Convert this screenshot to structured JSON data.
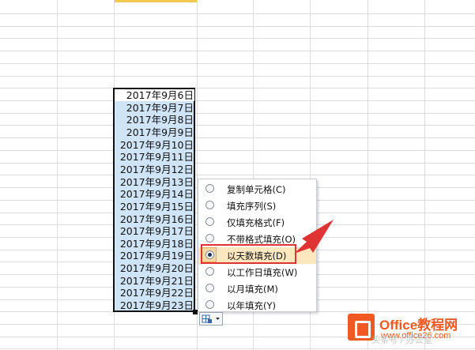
{
  "sheet": {
    "dates": [
      "2017年9月6日",
      "2017年9月7日",
      "2017年9月8日",
      "2017年9月9日",
      "2017年9月10日",
      "2017年9月11日",
      "2017年9月12日",
      "2017年9月13日",
      "2017年9月14日",
      "2017年9月15日",
      "2017年9月16日",
      "2017年9月17日",
      "2017年9月18日",
      "2017年9月19日",
      "2017年9月20日",
      "2017年9月21日",
      "2017年9月22日",
      "2017年9月23日"
    ]
  },
  "autofill_menu": {
    "options": [
      {
        "label": "复制单元格(C)",
        "checked": false
      },
      {
        "label": "填充序列(S)",
        "checked": false
      },
      {
        "label": "仅填充格式(F)",
        "checked": false
      },
      {
        "label": "不带格式填充(O)",
        "checked": false
      },
      {
        "label": "以天数填充(D)",
        "checked": true
      },
      {
        "label": "以工作日填充(W)",
        "checked": false
      },
      {
        "label": "以月填充(M)",
        "checked": false
      },
      {
        "label": "以年填充(Y)",
        "checked": false
      }
    ]
  },
  "logo": {
    "name": "Office教程网",
    "site": "www.office26.com"
  },
  "watermark": "头条号 / 办公室"
}
